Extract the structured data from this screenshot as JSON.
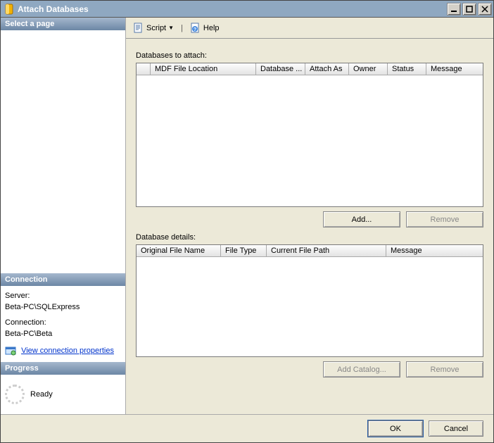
{
  "window": {
    "title": "Attach Databases"
  },
  "left": {
    "select_page_head": "Select a page",
    "connection_head": "Connection",
    "server_label": "Server:",
    "server_value": "Beta-PC\\SQLExpress",
    "connection_label": "Connection:",
    "connection_value": "Beta-PC\\Beta",
    "view_conn_props": "View connection properties",
    "progress_head": "Progress",
    "progress_status": "Ready"
  },
  "toolbar": {
    "script": "Script",
    "help": "Help"
  },
  "content": {
    "databases_to_attach_label": "Databases to attach:",
    "db_columns": {
      "mdf": "MDF File Location",
      "database": "Database ...",
      "attach_as": "Attach As",
      "owner": "Owner",
      "status": "Status",
      "message": "Message"
    },
    "add_btn": "Add...",
    "remove_btn": "Remove",
    "database_details_label": "Database details:",
    "detail_columns": {
      "orig": "Original File Name",
      "ftype": "File Type",
      "curpath": "Current File Path",
      "message": "Message"
    },
    "add_catalog_btn": "Add Catalog...",
    "remove2_btn": "Remove"
  },
  "footer": {
    "ok": "OK",
    "cancel": "Cancel"
  }
}
